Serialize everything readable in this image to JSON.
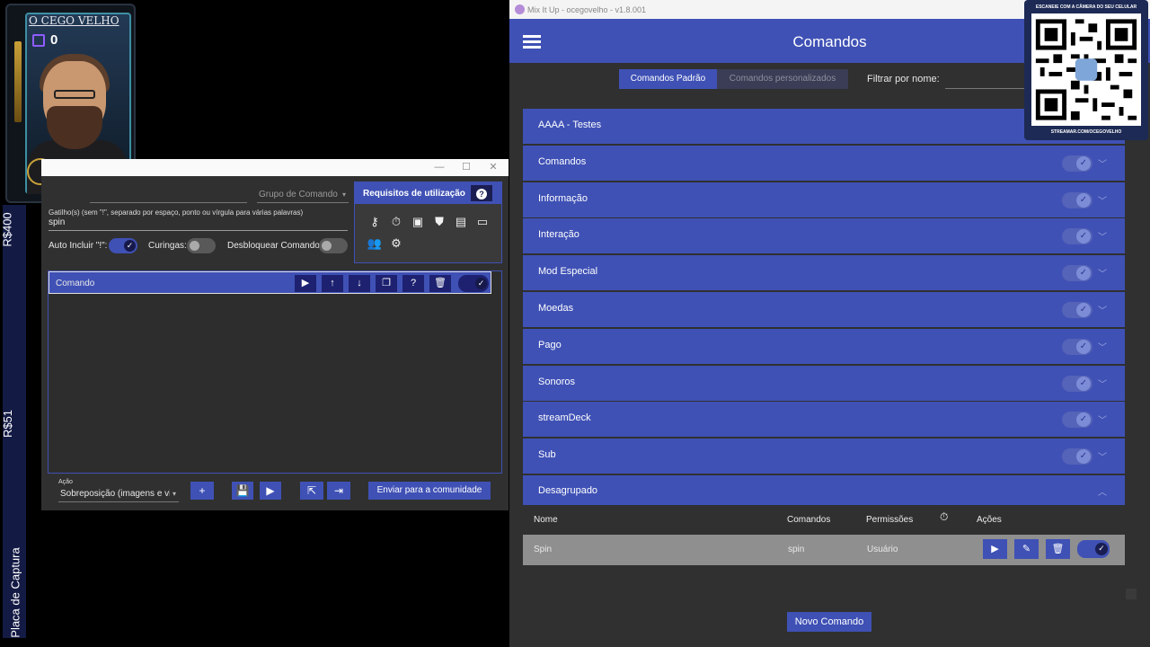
{
  "overlay": {
    "streamer_name": "O CEGO VELHO",
    "twitch_count": "0",
    "donation_labels": [
      "R$400",
      "R$51",
      "Placa de Captura"
    ]
  },
  "editor": {
    "group_placeholder": "Grupo de Comando",
    "trigger_hint": "Gatilho(s) (sem \"!\", separado por espaço, ponto ou vírgula para várias palavras)",
    "trigger_value": "spin",
    "auto_include_label": "Auto Incluir \"!\":",
    "wildcards_label": "Curingas:",
    "unlock_label": "Desbloquear Comando:",
    "requirements_title": "Requisitos de utilização",
    "command_row_label": "Comando",
    "action_label": "Ação",
    "action_value": "Sobreposição (imagens e vi",
    "community_button": "Enviar para a comunidade"
  },
  "mix": {
    "window_title": "Mix It Up - ocegovelho - v1.8.001",
    "page_title": "Comandos",
    "tabs": [
      "Comandos Padrão",
      "Comandos personalizados"
    ],
    "filter_label": "Filtrar por nome:",
    "groups": [
      "AAAA - Testes",
      "Comandos",
      "Informação",
      "Interação",
      "Mod Especial",
      "Moedas",
      "Pago",
      "Sonoros",
      "streamDeck",
      "Sub"
    ],
    "ungrouped_label": "Desagrupado",
    "table_headers": {
      "name": "Nome",
      "commands": "Comandos",
      "permissions": "Permissões",
      "actions": "Ações"
    },
    "row": {
      "name": "Spin",
      "commands": "spin",
      "permission": "Usuário"
    },
    "new_command_button": "Novo Comando"
  },
  "qr": {
    "header": "ESCANEIE COM A CÂMERA DO SEU CELULAR",
    "footer": "STREAMAR.COM/OCEGOVELHO"
  }
}
